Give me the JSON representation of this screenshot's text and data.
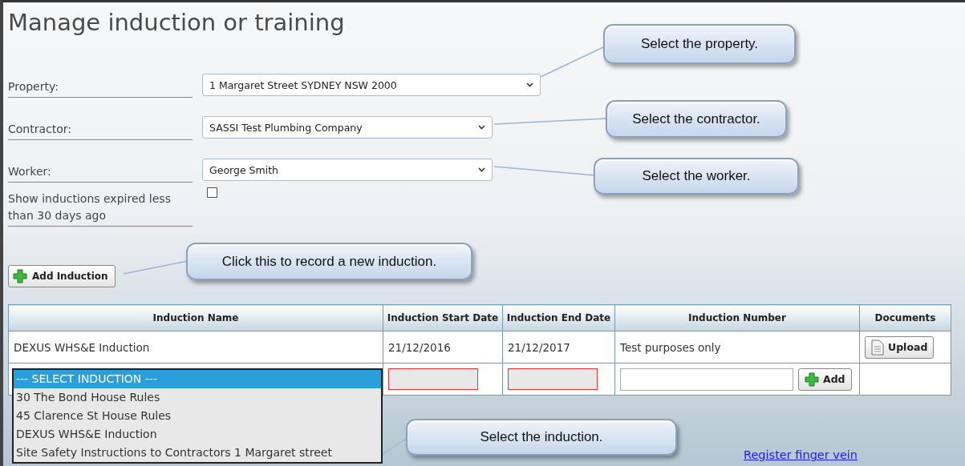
{
  "title": "Manage induction or training",
  "fields": [
    {
      "label": "Property:",
      "value": "1 Margaret Street SYDNEY NSW 2000"
    },
    {
      "label": "Contractor:",
      "value": "SASSI Test Plumbing Company"
    },
    {
      "label": "Worker:",
      "value": "George Smith"
    }
  ],
  "expired_filter": {
    "label": "Show inductions expired less than 30 days ago",
    "checked": false
  },
  "add_induction_button": "Add Induction",
  "table": {
    "columns": [
      "Induction Name",
      "Induction Start Date",
      "Induction End Date",
      "Induction Number",
      "Documents"
    ],
    "rows": [
      {
        "name": "DEXUS WHS&E Induction",
        "start": "21/12/2016",
        "end": "21/12/2017",
        "number": "Test purposes only",
        "upload_button": "Upload"
      }
    ],
    "new_row": {
      "induction_options": [
        {
          "label": "--- SELECT INDUCTION ---",
          "selected": true
        },
        {
          "label": "30 The Bond House Rules",
          "selected": false
        },
        {
          "label": "45 Clarence St House Rules",
          "selected": false
        },
        {
          "label": "DEXUS WHS&E Induction",
          "selected": false
        },
        {
          "label": "Site Safety Instructions to Contractors 1 Margaret street",
          "selected": false
        }
      ],
      "start_invalid": true,
      "end_invalid": true,
      "add_button": "Add"
    }
  },
  "link": "Register finger vein",
  "callouts": [
    "Select the property.",
    "Select the contractor.",
    "Select the worker.",
    "Click this to record a new induction.",
    "Select the induction."
  ]
}
